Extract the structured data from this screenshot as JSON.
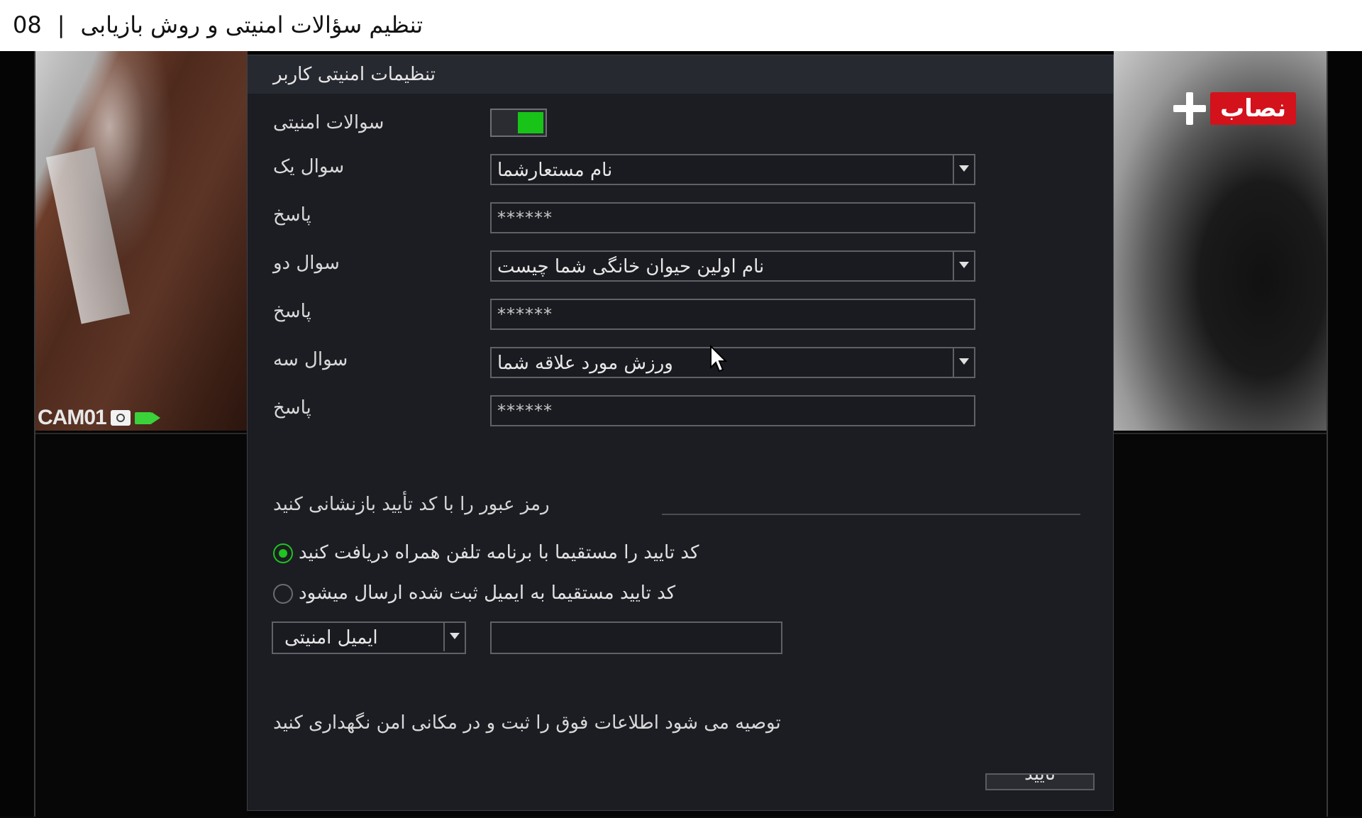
{
  "header": {
    "number": "08",
    "separator": "|",
    "title": "تنظیم سؤالات امنیتی و روش بازیابی"
  },
  "camera": {
    "label": "CAM01"
  },
  "logo": {
    "text": "نصاب"
  },
  "dialog": {
    "title": "تنظیمات امنیتی کاربر",
    "security_questions": {
      "label": "سوالات امنیتی",
      "enabled": true
    },
    "questions": [
      {
        "label": "سوال یک",
        "value": "نام مستعارشما",
        "answer_label": "پاسخ",
        "answer_mask": "******"
      },
      {
        "label": "سوال دو",
        "value": "نام اولین حیوان خانگی شما چیست",
        "answer_label": "پاسخ",
        "answer_mask": "******"
      },
      {
        "label": "سوال سه",
        "value": "ورزش مورد علاقه شما",
        "answer_label": "پاسخ",
        "answer_mask": "******"
      }
    ],
    "reset_section": {
      "title": "رمز عبور را با کد تأیید بازنشانی کنید",
      "options": [
        {
          "label": "کد تایید را مستقیما  با برنامه تلفن همراه دریافت کنید",
          "selected": true
        },
        {
          "label": "کد تایید مستقیما به ایمیل ثبت شده ارسال میشود",
          "selected": false
        }
      ],
      "email_select": "ایمیل امنیتی",
      "email_value": ""
    },
    "note": "توصیه می شود اطلاعات فوق را ثبت و در مکانی امن نگهداری کنید",
    "ok_label": "تایید"
  },
  "colors": {
    "accent_green": "#1fc41f",
    "logo_red": "#d3121b",
    "dialog_bg": "#1c1d23"
  }
}
